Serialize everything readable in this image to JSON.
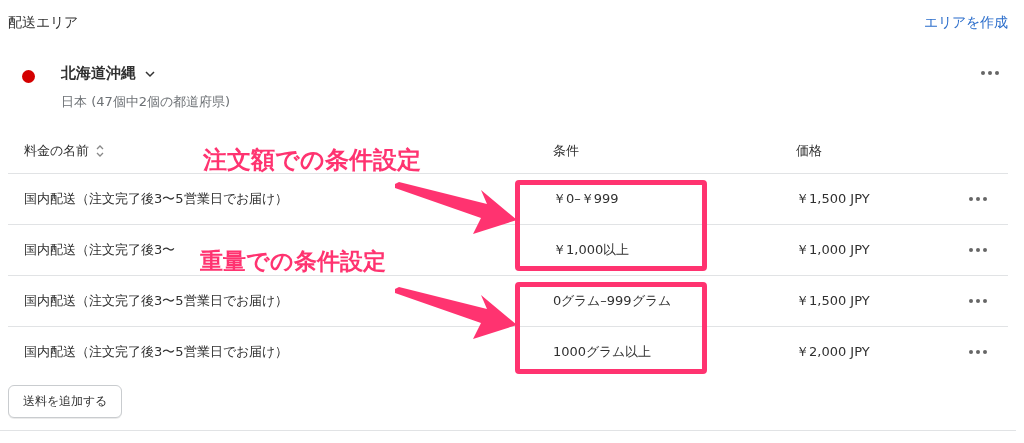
{
  "section": {
    "title": "配送エリア",
    "create_link": "エリアを作成"
  },
  "zone": {
    "name": "北海道沖縄",
    "subtitle": "日本 (47個中2個の都道府県)"
  },
  "table": {
    "columns": [
      "料金の名前",
      "条件",
      "価格"
    ],
    "rows": [
      {
        "name": "国内配送（注文完了後3〜5営業日でお届け）",
        "condition": "￥0–￥999",
        "price": "￥1,500 JPY"
      },
      {
        "name": "国内配送（注文完了後3〜",
        "condition": "￥1,000以上",
        "price": "￥1,000 JPY"
      },
      {
        "name": "国内配送（注文完了後3〜5営業日でお届け）",
        "condition": "0グラム–999グラム",
        "price": "￥1,500 JPY"
      },
      {
        "name": "国内配送（注文完了後3〜5営業日でお届け）",
        "condition": "1000グラム以上",
        "price": "￥2,000 JPY"
      }
    ]
  },
  "add_button": "送料を追加する",
  "annotations": [
    {
      "label": "注文額での条件設定"
    },
    {
      "label": "重量での条件設定"
    }
  ]
}
